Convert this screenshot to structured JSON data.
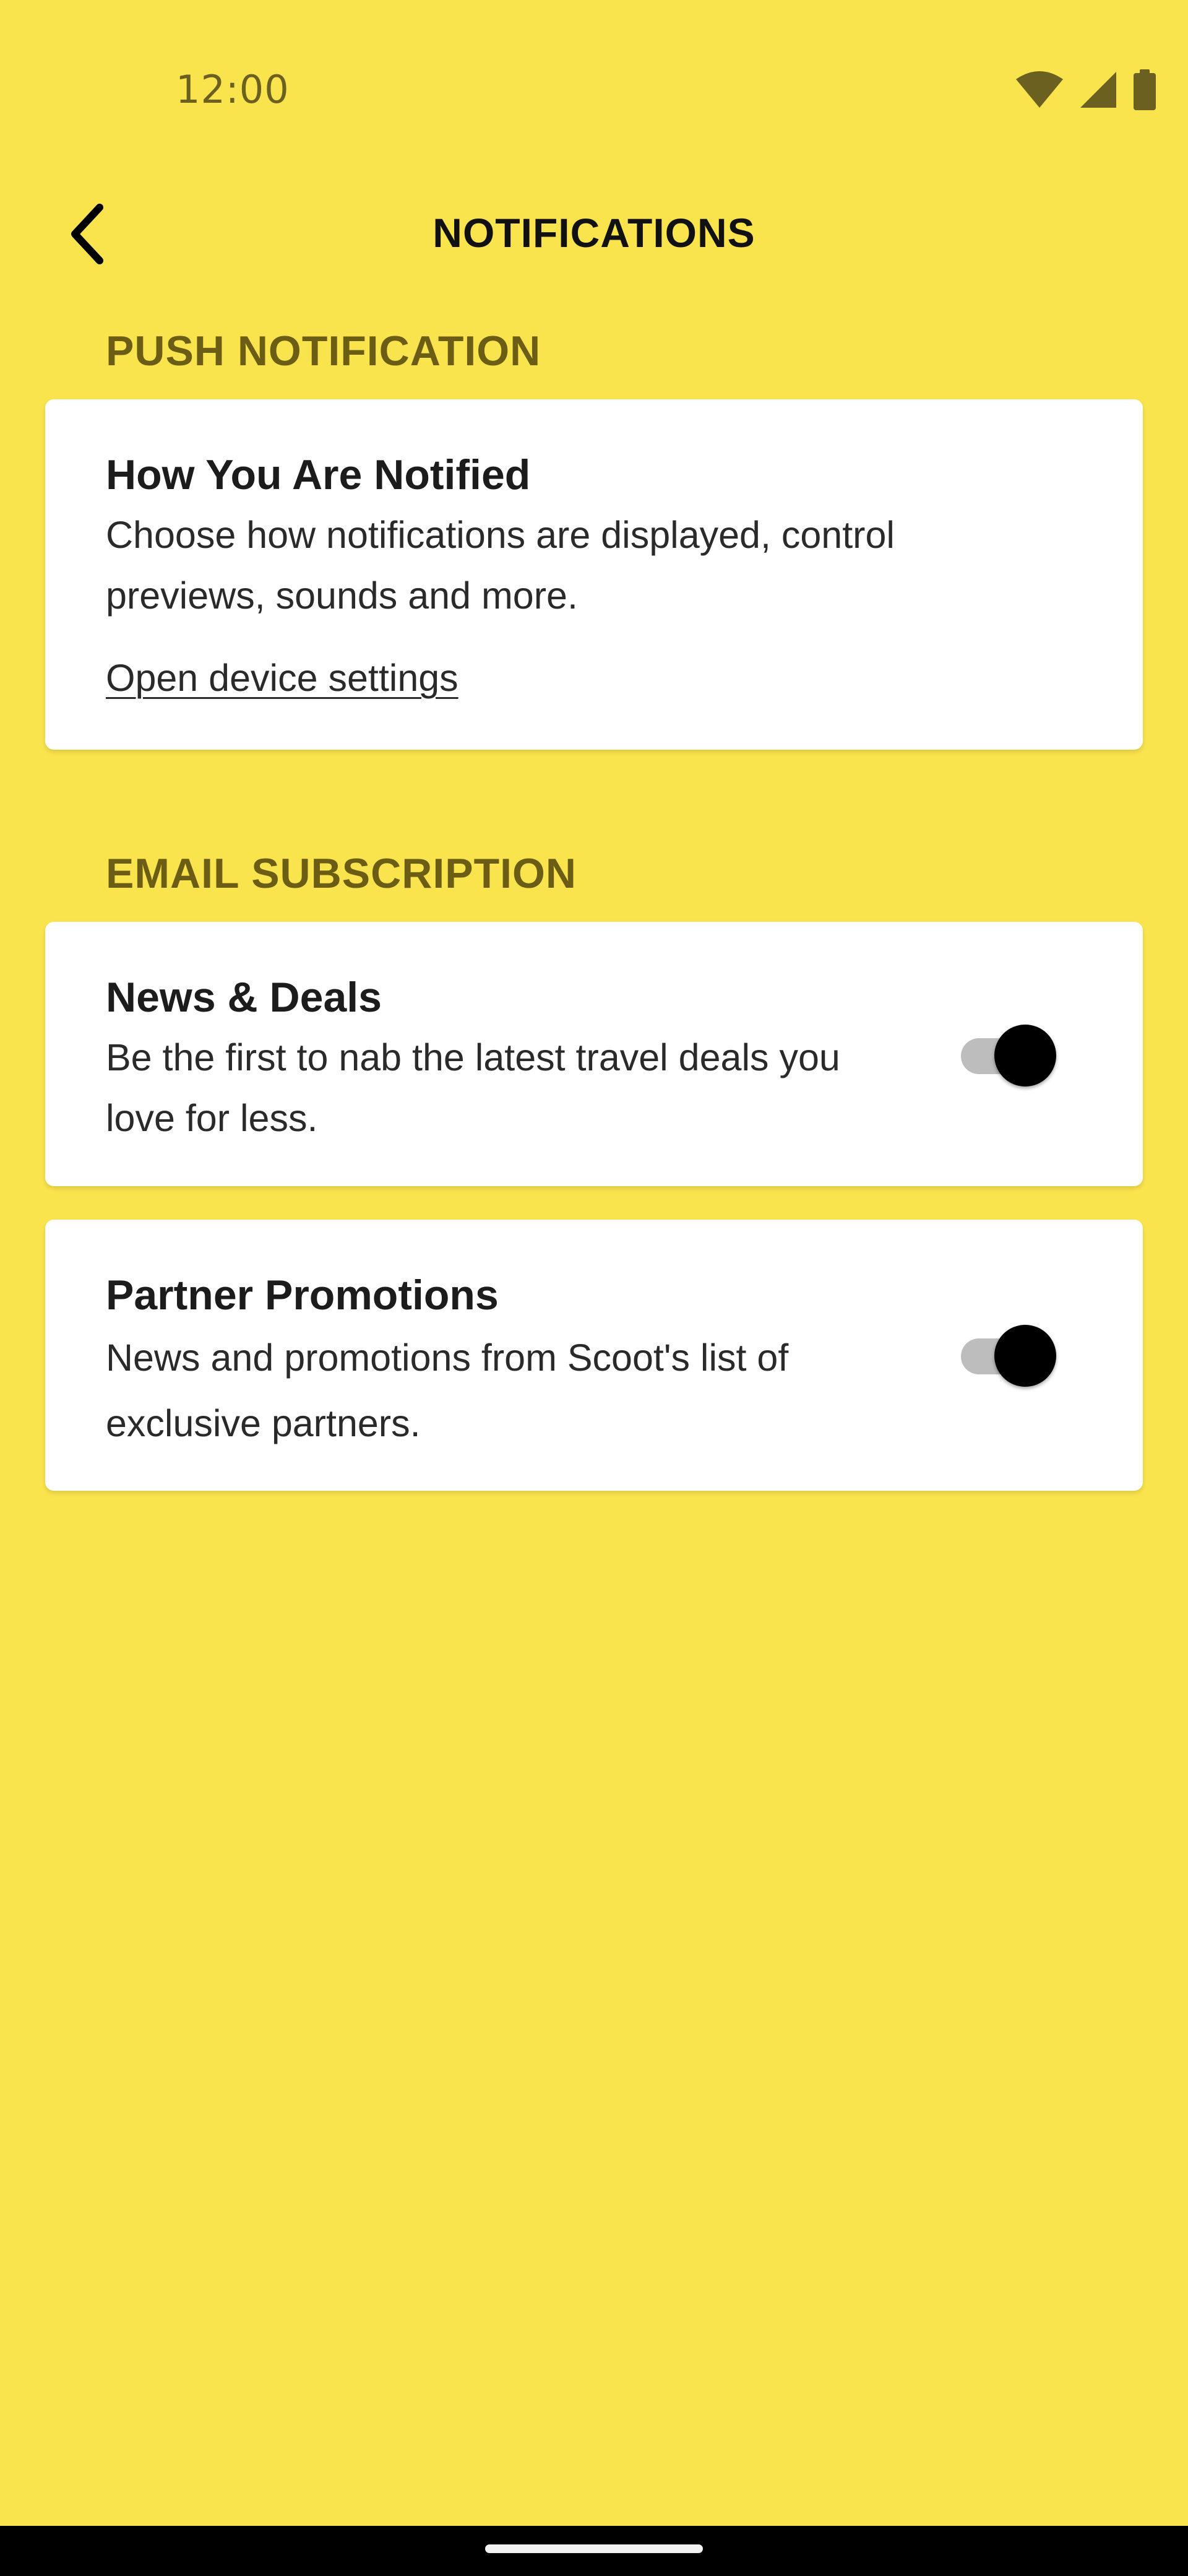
{
  "status_bar": {
    "time": "12:00",
    "icons": [
      "wifi-icon",
      "cellular-signal-icon",
      "battery-icon"
    ]
  },
  "header": {
    "back_icon": "chevron-left-icon",
    "title": "NOTIFICATIONS"
  },
  "push_section": {
    "header": "PUSH NOTIFICATION",
    "card": {
      "title": "How You Are Notified",
      "description": "Choose how notifications are displayed, control previews, sounds and more.",
      "link_label": "Open device settings"
    }
  },
  "email_section": {
    "header": "EMAIL SUBSCRIPTION",
    "items": [
      {
        "title": "News & Deals",
        "description": "Be the first to nab the latest travel deals you love for less.",
        "enabled": true
      },
      {
        "title": "Partner Promotions",
        "description": "News and promotions from Scoot's list of exclusive partners.",
        "enabled": true
      }
    ]
  },
  "colors": {
    "background": "#FAE44E",
    "section_header": "#6B5E14",
    "card": "#FFFFFF",
    "toggle_knob_on": "#000000",
    "toggle_track_on": "#BDBDBD"
  }
}
